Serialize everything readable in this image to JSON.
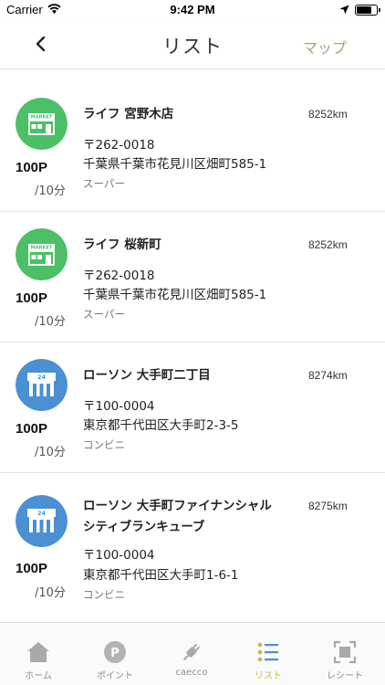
{
  "status_bar": {
    "carrier": "Carrier",
    "time": "9:42 PM"
  },
  "nav": {
    "title": "リスト",
    "map_link": "マップ"
  },
  "stores": [
    {
      "type": "market",
      "badge_text": "MARKET",
      "points": "100P",
      "per": "/10分",
      "name": "ライフ 宮野木店",
      "distance": "8252km",
      "zip": "〒262-0018",
      "address": "千葉県千葉市花見川区畑町585-1",
      "category": "スーパー",
      "color": "#4cbf67"
    },
    {
      "type": "market",
      "badge_text": "MARKET",
      "points": "100P",
      "per": "/10分",
      "name": "ライフ 桜新町",
      "distance": "8252km",
      "zip": "〒262-0018",
      "address": "千葉県千葉市花見川区畑町585-1",
      "category": "スーパー",
      "color": "#4cbf67"
    },
    {
      "type": "convenience",
      "badge_text": "24",
      "points": "100P",
      "per": "/10分",
      "name": "ローソン 大手町二丁目",
      "distance": "8274km",
      "zip": "〒100-0004",
      "address": "東京都千代田区大手町2-3-5",
      "category": "コンビニ",
      "color": "#4a90d2"
    },
    {
      "type": "convenience",
      "badge_text": "24",
      "points": "100P",
      "per": "/10分",
      "name": "ローソン 大手町ファイナンシャルシティブランキューブ",
      "distance": "8275km",
      "zip": "〒100-0004",
      "address": "東京都千代田区大手町1-6-1",
      "category": "コンビニ",
      "color": "#4a90d2"
    }
  ],
  "tabs": [
    {
      "label": "ホーム",
      "icon": "home-icon",
      "active": false
    },
    {
      "label": "ポイント",
      "icon": "points-icon",
      "icon_text": "P",
      "active": false
    },
    {
      "label": "caecco",
      "icon": "plug-icon",
      "active": false
    },
    {
      "label": "リスト",
      "icon": "list-icon",
      "active": true
    },
    {
      "label": "レシート",
      "icon": "receipt-scan-icon",
      "active": false
    }
  ],
  "colors": {
    "accent": "#c9b84a",
    "map_link": "#a2a67a",
    "market_green": "#4cbf67",
    "convenience_blue": "#4a90d2",
    "tab_inactive": "#8e8e8e"
  }
}
